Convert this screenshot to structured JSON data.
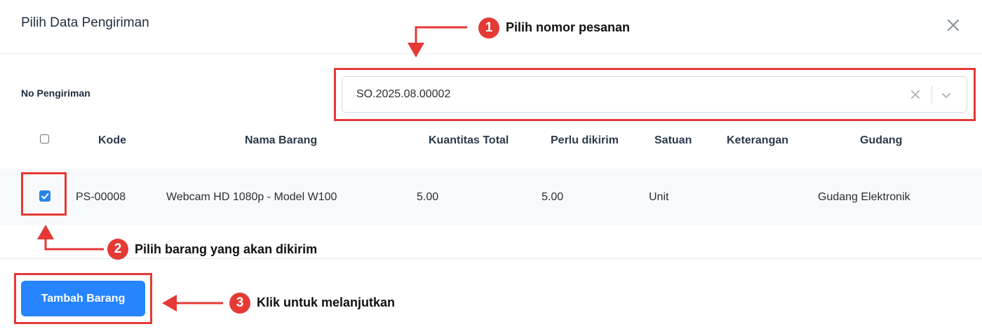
{
  "modal": {
    "title": "Pilih Data Pengiriman",
    "close_icon": "close-icon"
  },
  "shipment": {
    "label": "No Pengiriman",
    "selected_value": "SO.2025.08.00002",
    "clear_icon": "clear-icon",
    "dropdown_icon": "chevron-down-icon"
  },
  "table": {
    "headers": {
      "code": "Kode",
      "item_name": "Nama Barang",
      "total_qty": "Kuantitas Total",
      "to_ship": "Perlu dikirim",
      "unit": "Satuan",
      "notes": "Keterangan",
      "warehouse": "Gudang"
    },
    "header_checked": false,
    "rows": [
      {
        "checked": true,
        "code": "PS-00008",
        "item_name": "Webcam HD 1080p - Model W100",
        "total_qty": "5.00",
        "to_ship": "5.00",
        "unit": "Unit",
        "notes": "",
        "warehouse": "Gudang Elektronik"
      }
    ]
  },
  "footer": {
    "add_button_label": "Tambah Barang"
  },
  "annotations": {
    "step1": {
      "number": "1",
      "text": "Pilih nomor pesanan"
    },
    "step2": {
      "number": "2",
      "text": "Pilih barang yang akan dikirim"
    },
    "step3": {
      "number": "3",
      "text": "Klik untuk melanjutkan"
    }
  },
  "colors": {
    "primary": "#2684ff",
    "annotation_red": "#e53935",
    "row_background": "#f8f9fa"
  }
}
